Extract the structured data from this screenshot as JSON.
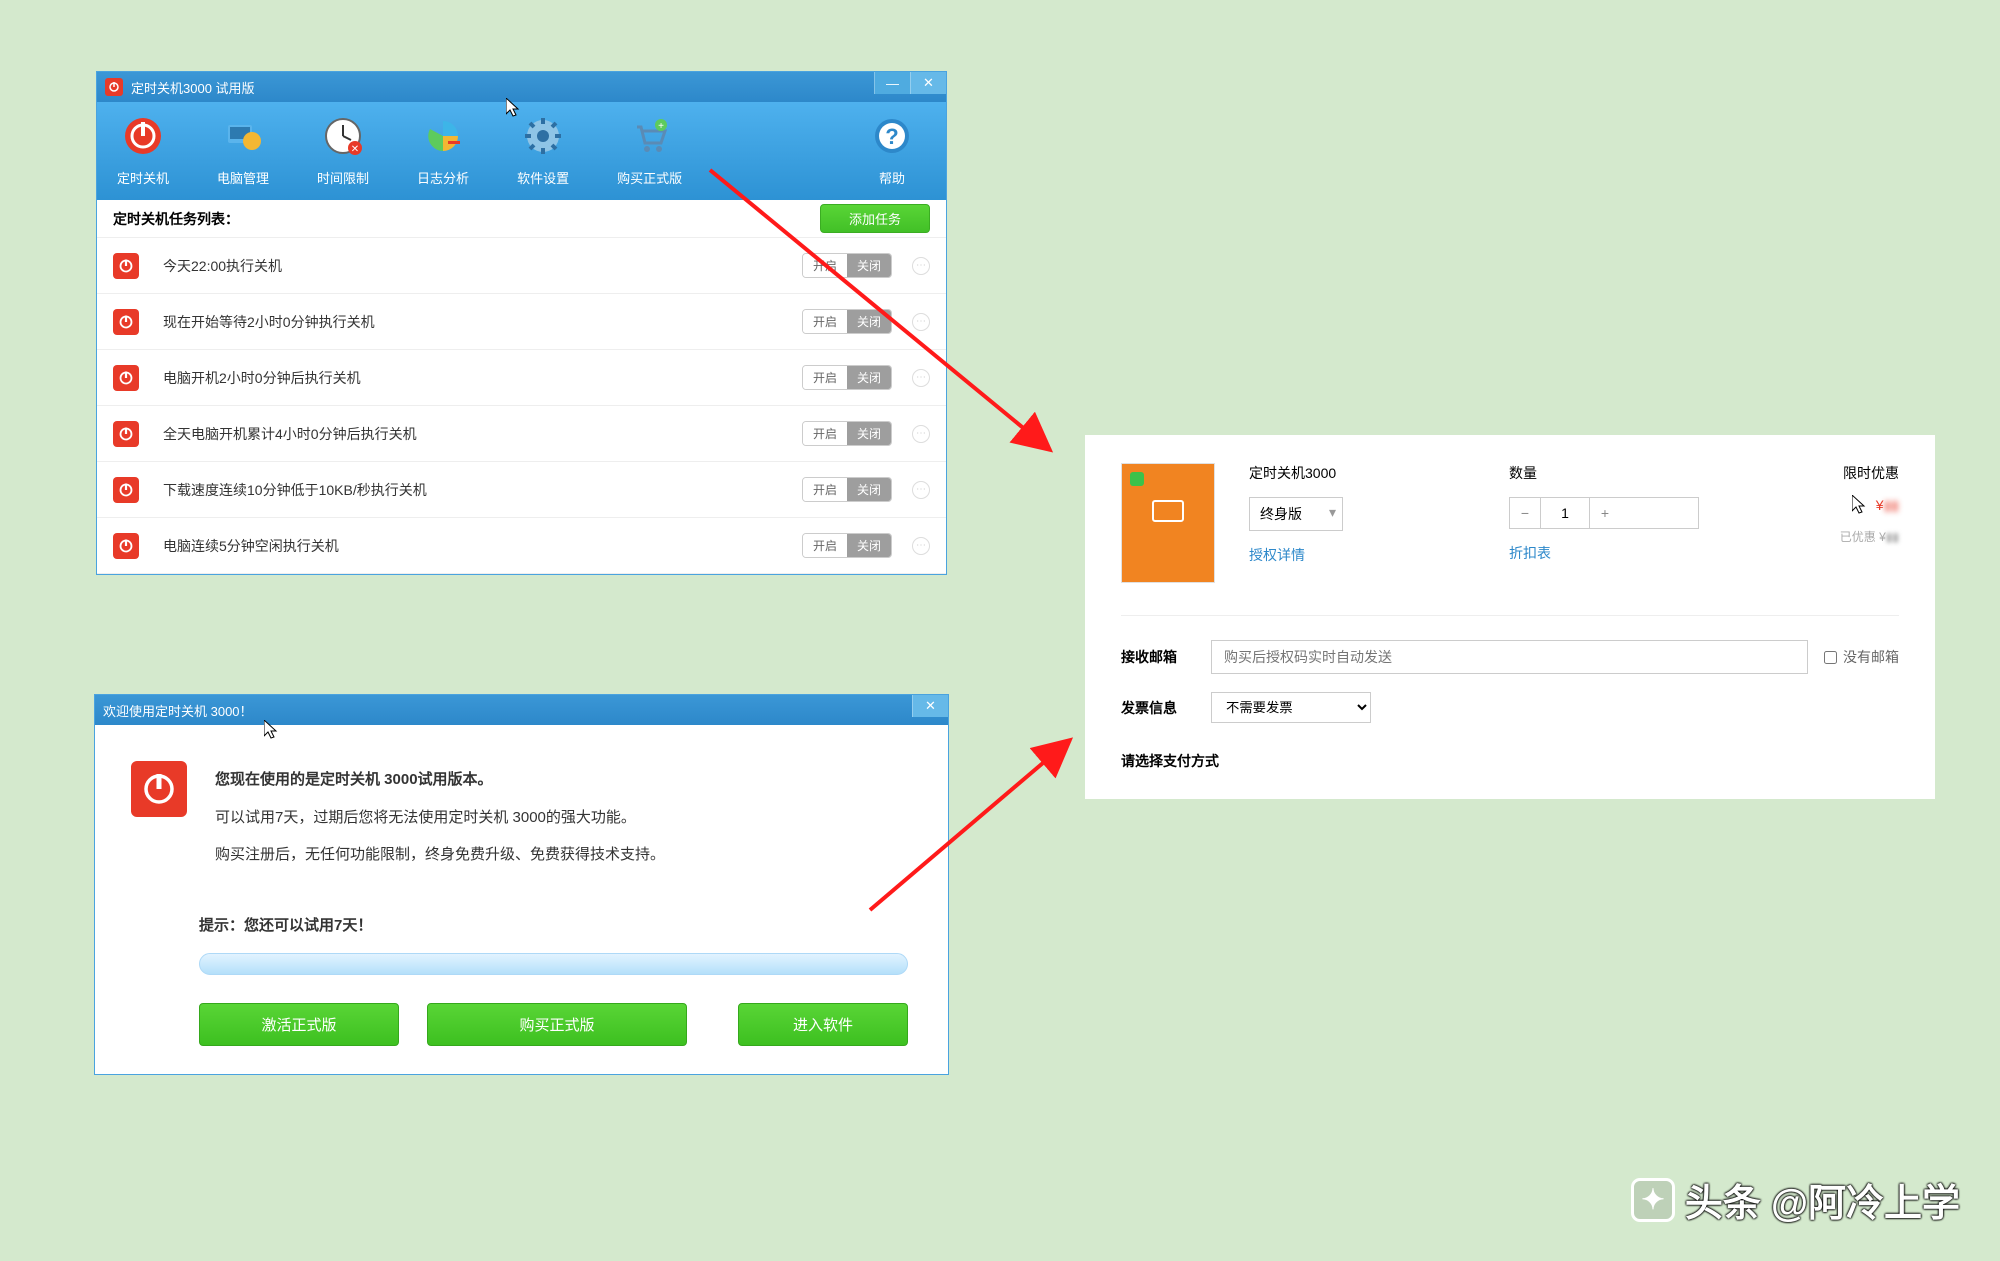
{
  "window1": {
    "title": "定时关机3000 试用版",
    "toolbar": [
      {
        "label": "定时关机",
        "icon": "power"
      },
      {
        "label": "电脑管理",
        "icon": "pc-manage"
      },
      {
        "label": "时间限制",
        "icon": "time-limit"
      },
      {
        "label": "日志分析",
        "icon": "log"
      },
      {
        "label": "软件设置",
        "icon": "settings"
      },
      {
        "label": "购买正式版",
        "icon": "cart"
      }
    ],
    "help_label": "帮助",
    "task_list_title": "定时关机任务列表：",
    "add_task_label": "添加任务",
    "toggle_on": "开启",
    "toggle_off": "关闭",
    "tasks": [
      "今天22:00执行关机",
      "现在开始等待2小时0分钟执行关机",
      "电脑开机2小时0分钟后执行关机",
      "全天电脑开机累计4小时0分钟后执行关机",
      "下载速度连续10分钟低于10KB/秒执行关机",
      "电脑连续5分钟空闲执行关机"
    ]
  },
  "window2": {
    "title": "欢迎使用定时关机 3000！",
    "line1": "您现在使用的是定时关机 3000试用版本。",
    "line2": "可以试用7天，过期后您将无法使用定时关机 3000的强大功能。",
    "line3": "购买注册后，无任何功能限制，终身免费升级、免费获得技术支持。",
    "tip": "提示：您还可以试用7天！",
    "btn1": "激活正式版",
    "btn2": "购买正式版",
    "btn3": "进入软件"
  },
  "purchase": {
    "product_name": "定时关机3000",
    "version_label": "终身版",
    "auth_details": "授权详情",
    "qty_label": "数量",
    "qty_value": "1",
    "discount_table": "折扣表",
    "limited_offer": "限时优惠",
    "price_symbol": "¥",
    "saved_label": "已优惠 ¥",
    "email_label": "接收邮箱",
    "email_placeholder": "购买后授权码实时自动发送",
    "no_email_label": "没有邮箱",
    "invoice_label": "发票信息",
    "invoice_value": "不需要发票",
    "pay_header": "请选择支付方式"
  },
  "watermark": {
    "prefix": "头条",
    "author": "@阿冷上学"
  }
}
